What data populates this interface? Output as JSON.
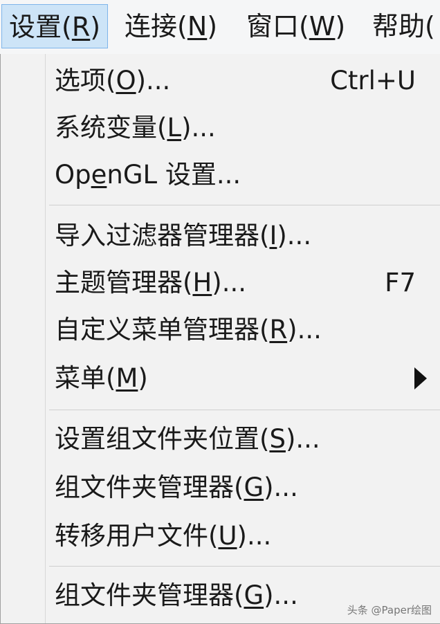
{
  "menubar": {
    "items": [
      {
        "text": "设置(",
        "key": "R",
        "tail": ")"
      },
      {
        "text": "连接(",
        "key": "N",
        "tail": ")"
      },
      {
        "text": "窗口(",
        "key": "W",
        "tail": ")"
      },
      {
        "text": "帮助(",
        "key": "",
        "tail": ""
      }
    ]
  },
  "menu": {
    "items": [
      {
        "pre": "选项(",
        "key": "O",
        "post": ")...",
        "shortcut": "Ctrl+U"
      },
      {
        "pre": "系统变量(",
        "key": "L",
        "post": ")..."
      },
      {
        "pre": "Op",
        "key": "e",
        "post": "nGL 设置..."
      },
      {
        "pre": "导入过滤器管理器(",
        "key": "I",
        "post": ")..."
      },
      {
        "pre": "主题管理器(",
        "key": "H",
        "post": ")...",
        "shortcut": "F7"
      },
      {
        "pre": "自定义菜单管理器(",
        "key": "R",
        "post": ")..."
      },
      {
        "pre": "菜单(",
        "key": "M",
        "post": ")",
        "submenu": true
      },
      {
        "pre": "设置组文件夹位置(",
        "key": "S",
        "post": ")..."
      },
      {
        "pre": "组文件夹管理器(",
        "key": "G",
        "post": ")..."
      },
      {
        "pre": "转移用户文件(",
        "key": "U",
        "post": ")..."
      },
      {
        "pre": "组文件夹管理器(",
        "key": "G",
        "post": ")..."
      }
    ]
  },
  "watermark": "头条 @Paper绘图"
}
